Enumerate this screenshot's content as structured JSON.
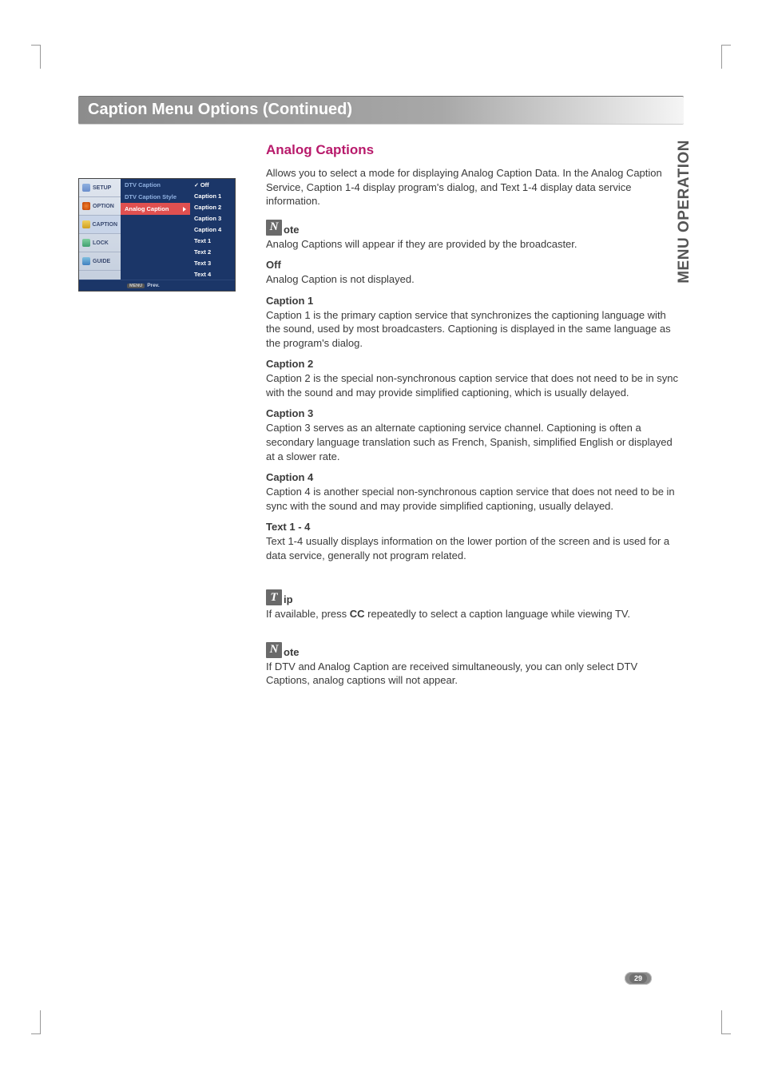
{
  "sideTab": "MENU OPERATION",
  "pageNumber": "29",
  "titleBar": "Caption Menu Options (Continued)",
  "osd": {
    "tabs": [
      "SETUP",
      "OPTION",
      "CAPTION",
      "LOCK",
      "GUIDE"
    ],
    "midRows": [
      "DTV Caption",
      "DTV Caption Style"
    ],
    "midSelected": "Analog Caption",
    "options": [
      "Off",
      "Caption 1",
      "Caption 2",
      "Caption 3",
      "Caption 4",
      "Text 1",
      "Text 2",
      "Text 3",
      "Text 4"
    ],
    "selectedOption": "Off",
    "footer": "Prev."
  },
  "section": {
    "heading": "Analog Captions",
    "intro": "Allows you to select a mode for displaying Analog Caption Data. In the Analog Caption Service, Caption 1-4 display program's dialog, and Text 1-4 display data service information.",
    "note1_label": "ote",
    "note1_glyph": "N",
    "note1_body": "Analog Captions will appear if they are provided by the broadcaster.",
    "defs": [
      {
        "h": "Off",
        "b": "Analog Caption is not displayed."
      },
      {
        "h": "Caption 1",
        "b": "Caption 1 is the primary caption service that synchronizes the captioning language with the sound, used by most broadcasters.  Captioning is displayed in the same language as the program's dialog."
      },
      {
        "h": "Caption 2",
        "b": "Caption 2 is the special non-synchronous caption service that does not need to be in sync with the sound and may provide simplified captioning, which is usually delayed."
      },
      {
        "h": "Caption 3",
        "b": "Caption 3 serves as an alternate captioning service channel.  Captioning is often a secondary language translation such as French, Spanish, simplified English or displayed at a slower rate."
      },
      {
        "h": "Caption 4",
        "b": "Caption 4 is another special non-synchronous caption service that does not need to be in sync with the sound and may provide simplified captioning, usually delayed."
      },
      {
        "h": "Text 1 - 4",
        "b": "Text 1-4 usually displays information on the lower portion of the screen and is used for a data service, generally not program related."
      }
    ],
    "tip_label": "ip",
    "tip_glyph": "T",
    "tip_body_pre": "If available, press ",
    "tip_body_bold": "CC",
    "tip_body_post": " repeatedly to select a caption language while viewing TV.",
    "note2_label": "ote",
    "note2_glyph": "N",
    "note2_body": "If DTV and Analog Caption are received simultaneously, you can only select DTV Captions, analog captions will not appear."
  }
}
